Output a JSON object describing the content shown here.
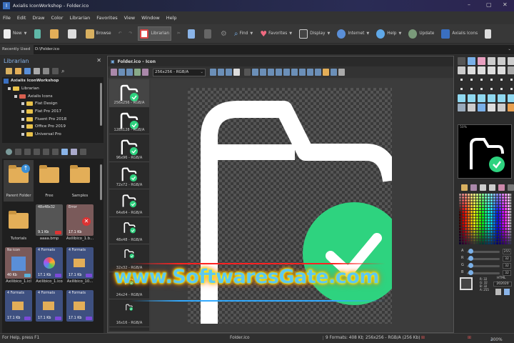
{
  "window": {
    "title": "Axialis IconWorkshop - Folder.ico",
    "controls": [
      "–",
      "▢",
      "✕"
    ]
  },
  "menu": [
    "File",
    "Edit",
    "Draw",
    "Color",
    "Librarian",
    "Favorites",
    "View",
    "Window",
    "Help"
  ],
  "toolbar": {
    "new": "New",
    "browse": "Browse",
    "librarian": "Librarian",
    "find": "Find",
    "favorites": "Favorites",
    "display": "Display",
    "internet": "Internet",
    "help": "Help",
    "update": "Update",
    "axialis_icons": "Axialis Icons"
  },
  "recent": {
    "label": "Recently Used",
    "value": "D:\\Folder.ico"
  },
  "librarian": {
    "title": "Librarian",
    "tree": [
      {
        "label": "Axialis IconWorkshop",
        "level": 0
      },
      {
        "label": "Librarian",
        "level": 1
      },
      {
        "label": "Axialis Icons",
        "level": 2
      },
      {
        "label": "Flat Design",
        "level": 3
      },
      {
        "label": "Flat Pro 2017",
        "level": 3
      },
      {
        "label": "Fluent Pro 2018",
        "level": 3
      },
      {
        "label": "Office Pro 2019",
        "level": 3
      },
      {
        "label": "Universal Pro",
        "level": 3
      }
    ],
    "thumbs": [
      {
        "label": "Parent Folder"
      },
      {
        "label": "Free"
      },
      {
        "label": "Samples"
      },
      {
        "label": "Tutorials"
      },
      {
        "label": "aaaa.bmp",
        "top": "48x48x32",
        "size": "9.1 Kb"
      },
      {
        "label": "Axilibico_1.b...",
        "top": "Error",
        "size": "17.1 Kb"
      },
      {
        "label": "Axilibico_1.icl",
        "top": "No icon",
        "size": "40 Kb"
      },
      {
        "label": "Axilibico_1.ico",
        "top": "4 Formats",
        "size": "17.1 Kb"
      },
      {
        "label": "Axilibico_10...",
        "top": "4 Formats",
        "size": "17.1 Kb"
      },
      {
        "label": "",
        "top": "4 Formats",
        "size": "17.1 Kb"
      },
      {
        "label": "",
        "top": "4 Formats",
        "size": "17.1 Kb"
      },
      {
        "label": "",
        "top": "4 Formats",
        "size": "17.1 Kb"
      }
    ]
  },
  "document": {
    "title": "Folder.ico - Icon",
    "format_select": "256x256 - RGB/A",
    "formats": [
      "256x256 - RGB/A",
      "128x128 - RGB/A",
      "96x96 - RGB/A",
      "72x72 - RGB/A",
      "64x64 - RGB/A",
      "48x48 - RGB/A",
      "32x32 - RGB/A",
      "24x24 - RGB/A",
      "16x16 - RGB/A"
    ],
    "selected_index": 0
  },
  "right_panel": {
    "preview_zoom": "50%",
    "sliders": [
      {
        "label": "A",
        "value": "255"
      },
      {
        "label": "R",
        "value": "32"
      },
      {
        "label": "G",
        "value": "32"
      },
      {
        "label": "B",
        "value": "32"
      }
    ],
    "html_label": "HTML",
    "hex": "202020",
    "channels": [
      "R: 32",
      "G: 32",
      "B: 32",
      "A: 255"
    ]
  },
  "status": {
    "help": "For Help, press F1",
    "file": "Folder.ico",
    "formats": "9 Formats: 408 Kb",
    "format": "256x256 - RGB/A (256 Kb)",
    "zoom": "300%"
  },
  "watermark": "www.SoftwaresGate.com",
  "colors": {
    "accent_green": "#2ed37f",
    "folder": "#e3ae58",
    "title_blue": "#8ab4e8"
  }
}
